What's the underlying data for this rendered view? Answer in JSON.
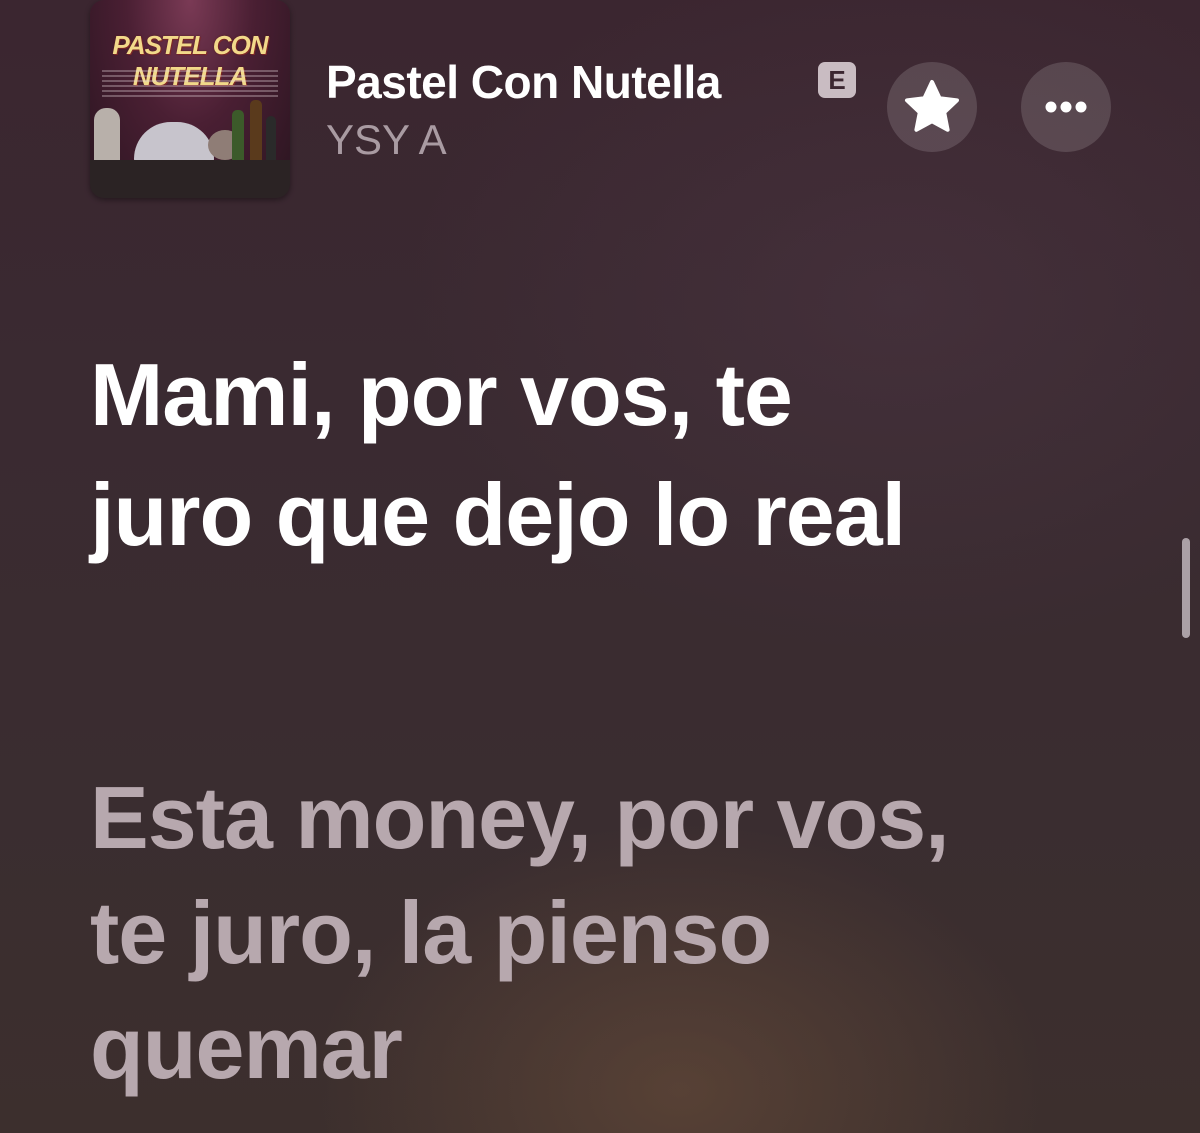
{
  "song": {
    "title": "Pastel Con Nutella",
    "explicit_badge": "E",
    "artist": "YSY A",
    "artwork_text": "PASTEL CON NUTELLA"
  },
  "controls": {
    "favorite_icon": "star-icon",
    "more_icon": "ellipsis-icon"
  },
  "lyrics": {
    "active_line": "Mami, por vos, te juro que dejo lo real",
    "next_line": "Esta money, por vos, te juro, la pienso quemar"
  },
  "colors": {
    "active_text": "#ffffff",
    "inactive_text": "#b7a8ae",
    "artist_text": "#a99ba2"
  }
}
